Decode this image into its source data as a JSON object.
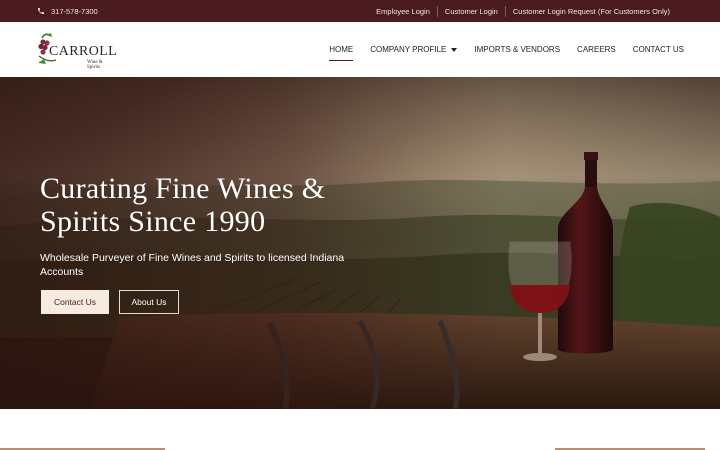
{
  "topbar": {
    "phone": "317-578-7300",
    "links": [
      "Employee Login",
      "Customer Login",
      "Customer Login Request (For Customers Only)"
    ]
  },
  "logo": {
    "name": "CARROLL",
    "tagline": "Wine & Spirits"
  },
  "nav": {
    "items": [
      "HOME",
      "COMPANY PROFILE",
      "IMPORTS & VENDORS",
      "CAREERS",
      "CONTACT US"
    ],
    "active": "HOME"
  },
  "hero": {
    "title": "Curating Fine Wines & Spirits Since 1990",
    "subtitle": "Wholesale Purveyer of Fine Wines and Spirits to licensed Indiana Accounts",
    "buttons": {
      "primary": "Contact Us",
      "secondary": "About Us"
    }
  },
  "icons": {
    "phone": "phone-icon",
    "dropdown": "caret-down-icon"
  },
  "colors": {
    "brand": "#4a1b1f",
    "button_fill": "#f5ecdd",
    "wine": "#8b1118"
  }
}
